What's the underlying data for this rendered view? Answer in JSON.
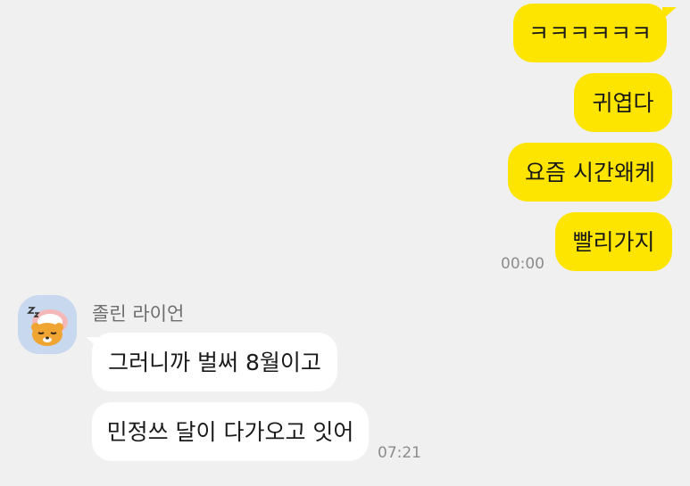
{
  "chat": {
    "outgoing": [
      {
        "text": "ㅋㅋㅋㅋㅋㅋ"
      },
      {
        "text": "귀엽다"
      },
      {
        "text": "요즘 시간왜케"
      },
      {
        "text": "빨리가지"
      }
    ],
    "outgoing_time": "00:00",
    "incoming_sender": "졸린 라이언",
    "incoming": [
      {
        "text": "그러니까 벌써 8월이고"
      },
      {
        "text": "민정쓰 달이 다가오고 잇어"
      }
    ],
    "incoming_time": "07:21"
  },
  "colors": {
    "background": "#f0f0f0",
    "my_bubble": "#fee500",
    "their_bubble": "#ffffff"
  },
  "avatar": {
    "icon": "sleeping-lion-character-icon"
  }
}
